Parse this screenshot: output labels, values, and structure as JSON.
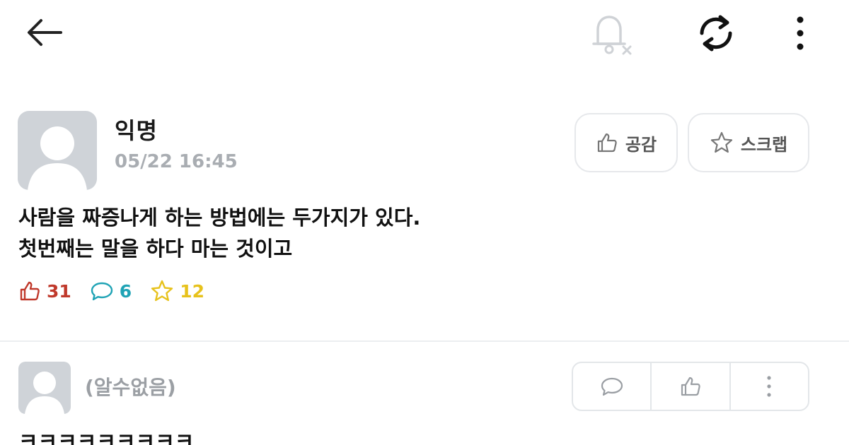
{
  "topbar": {
    "back_icon": "arrow-left-icon",
    "bell_icon": "bell-off-icon",
    "refresh_icon": "refresh-icon",
    "more_icon": "more-vertical-icon"
  },
  "post": {
    "author": "익명",
    "time": "05/22 16:45",
    "like_button_label": "공감",
    "scrap_button_label": "스크랩",
    "body_lines": [
      "사람을 짜증나게 하는 방법에는 두가지가 있다.",
      "첫번째는 말을 하다 마는 것이고"
    ],
    "likes": "31",
    "comments": "6",
    "scraps": "12"
  },
  "comment": {
    "author": "(알수없음)",
    "text": "ㅋㅋㅋㅋㅋㅋㅋㅋㅋ"
  },
  "colors": {
    "like": "#c0392b",
    "comment": "#1fa3b5",
    "scrap": "#e7c21c",
    "muted": "#a9adb2",
    "avatar": "#cfd3d8"
  }
}
